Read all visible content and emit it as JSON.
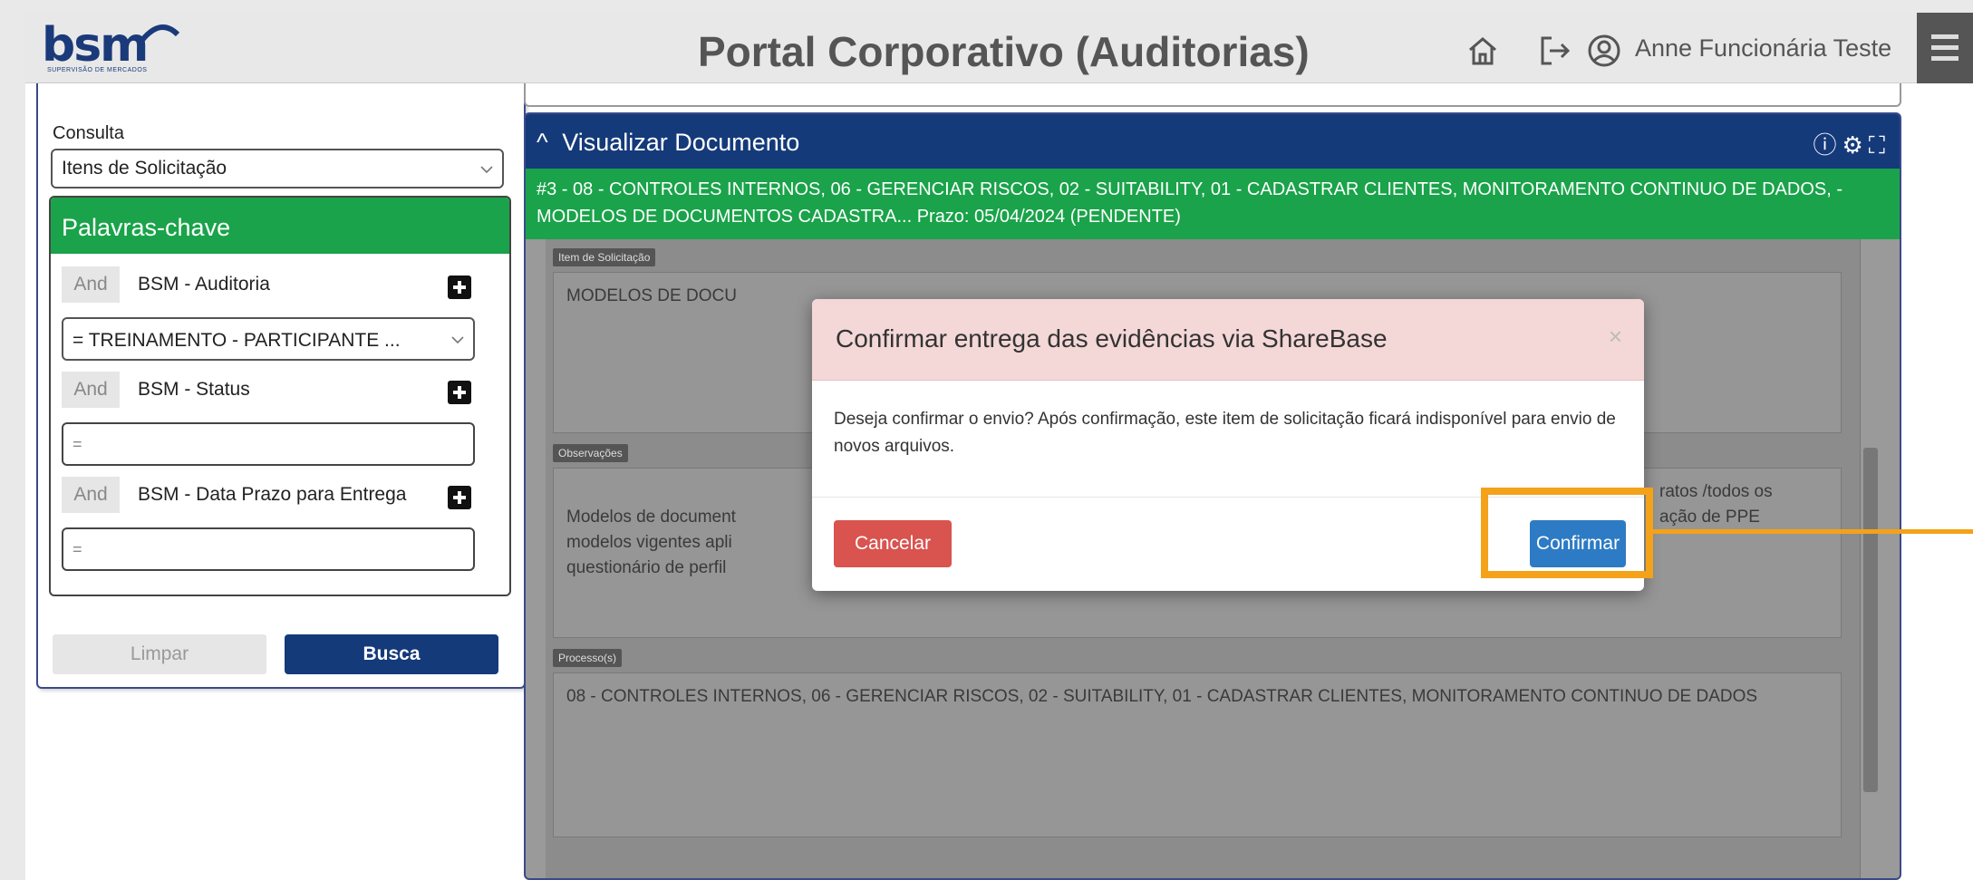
{
  "header": {
    "logo_text": "bsm",
    "logo_sub": "SUPERVISÃO DE MERCADOS",
    "title": "Portal Corporativo (Auditorias)",
    "user_name": "Anne Funcionária Teste",
    "icons": [
      "home-icon",
      "logout-icon",
      "user-circle-icon",
      "hamburger-menu-icon"
    ]
  },
  "sidebar": {
    "consulta_label": "Consulta",
    "consulta_value": "Itens de Solicitação",
    "keywords_title": "Palavras-chave",
    "filters": [
      {
        "op": "And",
        "label": "BSM - Auditoria",
        "value": "= TREINAMENTO - PARTICIPANTE ..."
      },
      {
        "op": "And",
        "label": "BSM - Status",
        "value": "="
      },
      {
        "op": "And",
        "label": "BSM - Data Prazo para Entrega",
        "value": "="
      }
    ],
    "clear_label": "Limpar",
    "search_label": "Busca"
  },
  "document": {
    "panel_title": "Visualizar Documento",
    "caret": "^",
    "head_icons": [
      "info-icon",
      "settings-icon",
      "expand-icon"
    ],
    "summary": "#3 - 08 - CONTROLES INTERNOS, 06 - GERENCIAR RISCOS, 02 - SUITABILITY, 01 - CADASTRAR CLIENTES, MONITORAMENTO CONTINUO DE DADOS, - MODELOS DE DOCUMENTOS CADASTRA... Prazo: 05/04/2024 (PENDENTE)",
    "fields": [
      {
        "tag": "Item de Solicitação",
        "text": "MODELOS DE DOCU"
      },
      {
        "tag": "Observações",
        "text_left": "Modelos de document\nmodelos vigentes apli\nquestionário de perfil",
        "text_right": "ratos /todos os\nação de PPE"
      },
      {
        "tag": "Processo(s)",
        "text": "08 - CONTROLES INTERNOS, 06 - GERENCIAR RISCOS, 02 - SUITABILITY, 01 - CADASTRAR CLIENTES, MONITORAMENTO CONTINUO DE DADOS"
      }
    ]
  },
  "modal": {
    "title": "Confirmar entrega das evidências via ShareBase",
    "close": "×",
    "message": "Deseja confirmar o envio? Após confirmação, este item de solicitação ficará indisponível para envio de novos arquivos.",
    "cancel_label": "Cancelar",
    "confirm_label": "Confirmar"
  },
  "colors": {
    "navy": "#143a7a",
    "green": "#1aa34a",
    "danger": "#d9534f",
    "primary": "#2d7bc4",
    "highlight": "#f4a21a",
    "modal_header": "#f4d7d7"
  }
}
